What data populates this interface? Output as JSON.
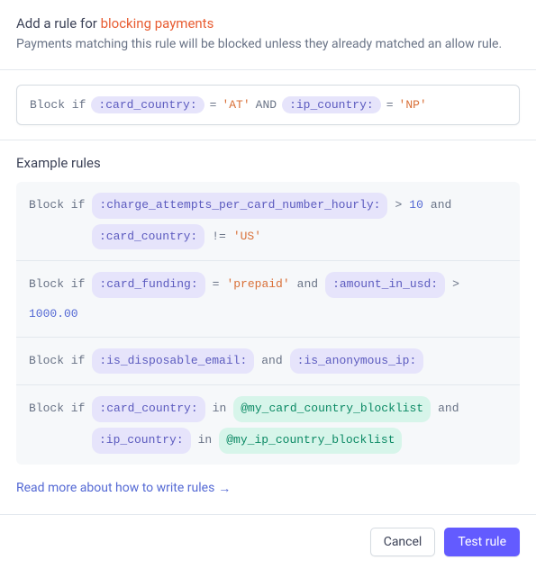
{
  "header": {
    "title_prefix": "Add a rule for ",
    "title_suffix": "blocking payments",
    "subtitle": "Payments matching this rule will be blocked unless they already matched an allow rule."
  },
  "rule_input": {
    "prefix": "Block if",
    "field1": ":card_country:",
    "op1": "=",
    "val1": "'AT'",
    "and": "AND",
    "field2": ":ip_country:",
    "op2": "=",
    "val2": "'NP'"
  },
  "examples": {
    "title": "Example rules",
    "rules": [
      {
        "prefix": "Block if",
        "parts": {
          "field1": ":charge_attempts_per_card_number_hourly:",
          "op1": ">",
          "num1": "10",
          "and1": "and",
          "field2": ":card_country:",
          "op2": "!=",
          "val2": "'US'"
        }
      },
      {
        "prefix": "Block if",
        "parts": {
          "field1": ":card_funding:",
          "op1": "=",
          "val1": "'prepaid'",
          "and1": "and",
          "field2": ":amount_in_usd:",
          "op2": ">",
          "num2": "1000.00"
        }
      },
      {
        "prefix": "Block if",
        "parts": {
          "field1": ":is_disposable_email:",
          "and1": "and",
          "field2": ":is_anonymous_ip:"
        }
      },
      {
        "prefix": "Block if",
        "parts": {
          "field1": ":card_country:",
          "op1": "in",
          "list1": "@my_card_country_blocklist",
          "and1": "and",
          "field2": ":ip_country:",
          "op2": "in",
          "list2": "@my_ip_country_blocklist"
        }
      }
    ]
  },
  "read_more": {
    "text": "Read more about how to write rules",
    "arrow": "→"
  },
  "footer": {
    "cancel": "Cancel",
    "test_rule": "Test rule"
  }
}
